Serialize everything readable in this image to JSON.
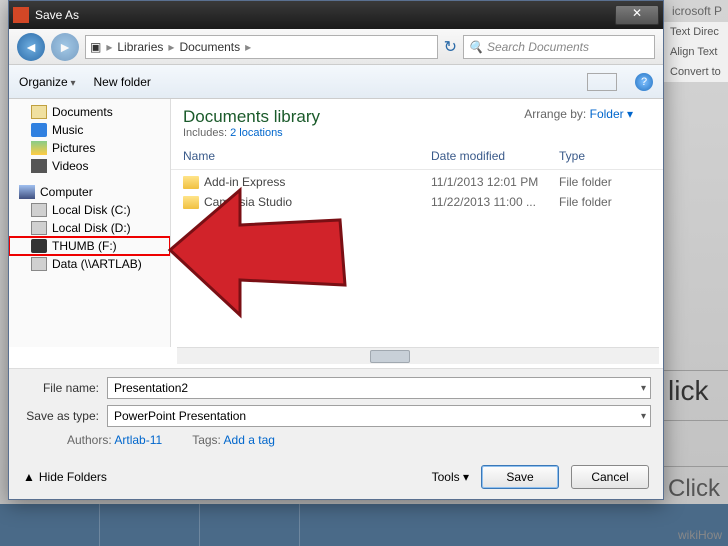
{
  "bg": {
    "app_title": "icrosoft P",
    "panel": [
      "Text Direc",
      "Align Text",
      "Convert to"
    ],
    "click1": "lick",
    "click2": "Click"
  },
  "dialog": {
    "title": "Save As",
    "breadcrumb": [
      "Libraries",
      "Documents"
    ],
    "search_placeholder": "Search Documents",
    "toolbar": {
      "organize": "Organize",
      "new_folder": "New folder"
    },
    "tree": {
      "lib_items": [
        {
          "label": "Documents",
          "icon": "doc"
        },
        {
          "label": "Music",
          "icon": "mus"
        },
        {
          "label": "Pictures",
          "icon": "pic"
        },
        {
          "label": "Videos",
          "icon": "vid"
        }
      ],
      "computer": "Computer",
      "drives": [
        {
          "label": "Local Disk (C:)",
          "icon": "drv"
        },
        {
          "label": "Local Disk (D:)",
          "icon": "drv"
        },
        {
          "label": "THUMB (F:)",
          "icon": "usb",
          "highlight": true
        },
        {
          "label": "Data (\\\\ARTLAB)",
          "icon": "drv"
        }
      ]
    },
    "library": {
      "title": "Documents library",
      "includes_label": "Includes:",
      "includes_link": "2 locations",
      "arrange_label": "Arrange by:",
      "arrange_value": "Folder"
    },
    "columns": [
      "Name",
      "Date modified",
      "Type"
    ],
    "rows": [
      {
        "name": "Add-in Express",
        "date": "11/1/2013 12:01 PM",
        "type": "File folder"
      },
      {
        "name": "Camtasia Studio",
        "date": "11/22/2013 11:00 ...",
        "type": "File folder"
      }
    ],
    "filename_label": "File name:",
    "filename": "Presentation2",
    "saveas_label": "Save as type:",
    "saveas": "PowerPoint Presentation",
    "authors_label": "Authors:",
    "authors": "Artlab-11",
    "tags_label": "Tags:",
    "tags": "Add a tag",
    "hide_folders": "Hide Folders",
    "tools": "Tools",
    "save": "Save",
    "cancel": "Cancel"
  },
  "watermark": "wikiHow"
}
